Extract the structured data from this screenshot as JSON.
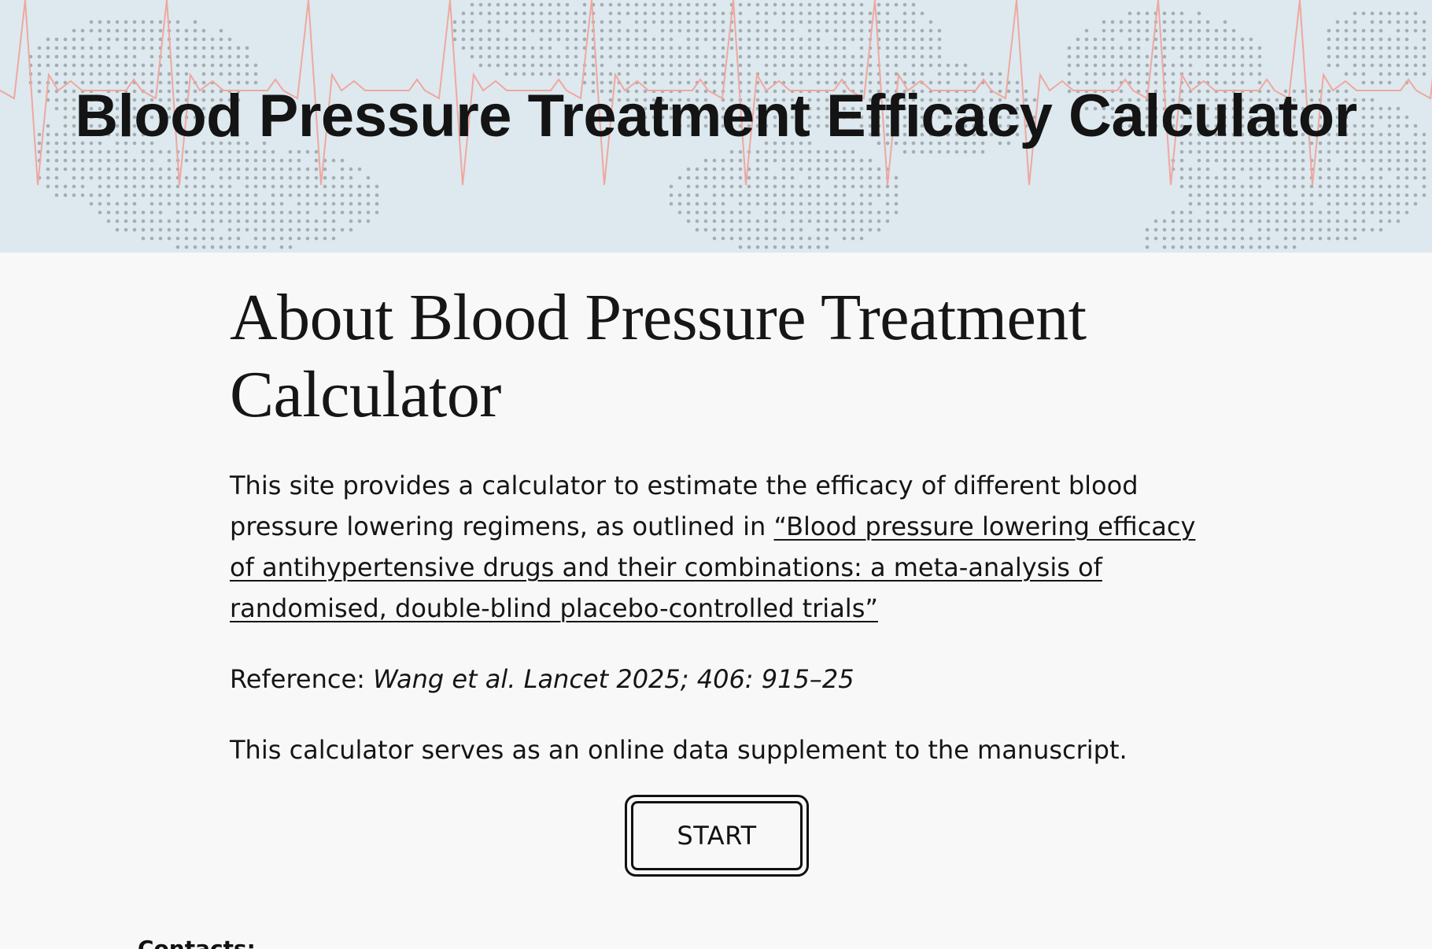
{
  "header": {
    "site_title": "Blood Pressure Treatment Efficacy Calculator"
  },
  "about": {
    "heading": "About Blood Pressure Treatment Calculator",
    "intro_text": "This site provides a calculator to estimate the efficacy of different blood pressure lowering regimens, as outlined in ",
    "paper_link_text": "“Blood pressure lowering efficacy of antihypertensive drugs and their combinations: a meta-analysis of randomised, double-blind placebo-controlled trials”",
    "reference_label": "Reference: ",
    "reference_citation": "Wang et al. Lancet 2025; 406: 915–25",
    "supplement_text": "This calculator serves as an online data supplement to the manuscript.",
    "start_label": "START"
  },
  "footer": {
    "contacts_label": "Contacts:"
  },
  "colors": {
    "banner_bg": "#dde9ee",
    "ecg_line": "#f0a7a0",
    "map_dots": "#9aa2a6",
    "page_bg": "#f8f8f8",
    "text": "#111111"
  }
}
